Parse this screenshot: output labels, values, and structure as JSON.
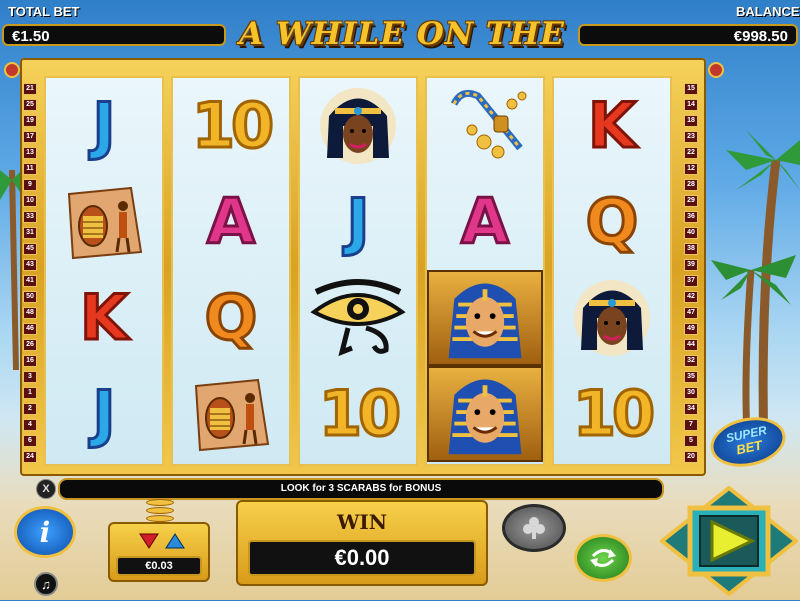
{
  "header": {
    "total_bet_label": "TOTAL BET",
    "total_bet_value": "€1.50",
    "title": "A WHILE ON THE NILE",
    "trademark": "™",
    "balance_label": "BALANCE",
    "balance_value": "€998.50"
  },
  "paylines": {
    "left": [
      "21",
      "25",
      "19",
      "17",
      "13",
      "11",
      "9",
      "10",
      "33",
      "31",
      "45",
      "43",
      "41",
      "50",
      "48",
      "46",
      "26",
      "16",
      "3",
      "1",
      "2",
      "4",
      "6",
      "24"
    ],
    "right": [
      "15",
      "14",
      "18",
      "23",
      "22",
      "12",
      "28",
      "29",
      "36",
      "40",
      "38",
      "39",
      "37",
      "42",
      "47",
      "49",
      "44",
      "32",
      "35",
      "30",
      "34",
      "7",
      "5",
      "20"
    ]
  },
  "reels": [
    [
      "J",
      "Scarab Tablet",
      "K",
      "J"
    ],
    [
      "10",
      "A",
      "Q",
      "Scarab Tablet"
    ],
    [
      "Cleopatra",
      "J",
      "Eye of Horus",
      "10"
    ],
    [
      "Crook & Coins",
      "A",
      "Pharaoh",
      "Pharaoh"
    ],
    [
      "K",
      "Q",
      "Cleopatra",
      "10"
    ]
  ],
  "info_bar": "LOOK for 3 SCARABS for BONUS",
  "controls": {
    "info_icon": "i",
    "music_icon": "♫",
    "close_icon": "X",
    "coin_value": "€0.03",
    "win_label": "WIN",
    "win_value": "€0.00",
    "super_bet_line1": "SUPER",
    "super_bet_line2": "BET"
  }
}
